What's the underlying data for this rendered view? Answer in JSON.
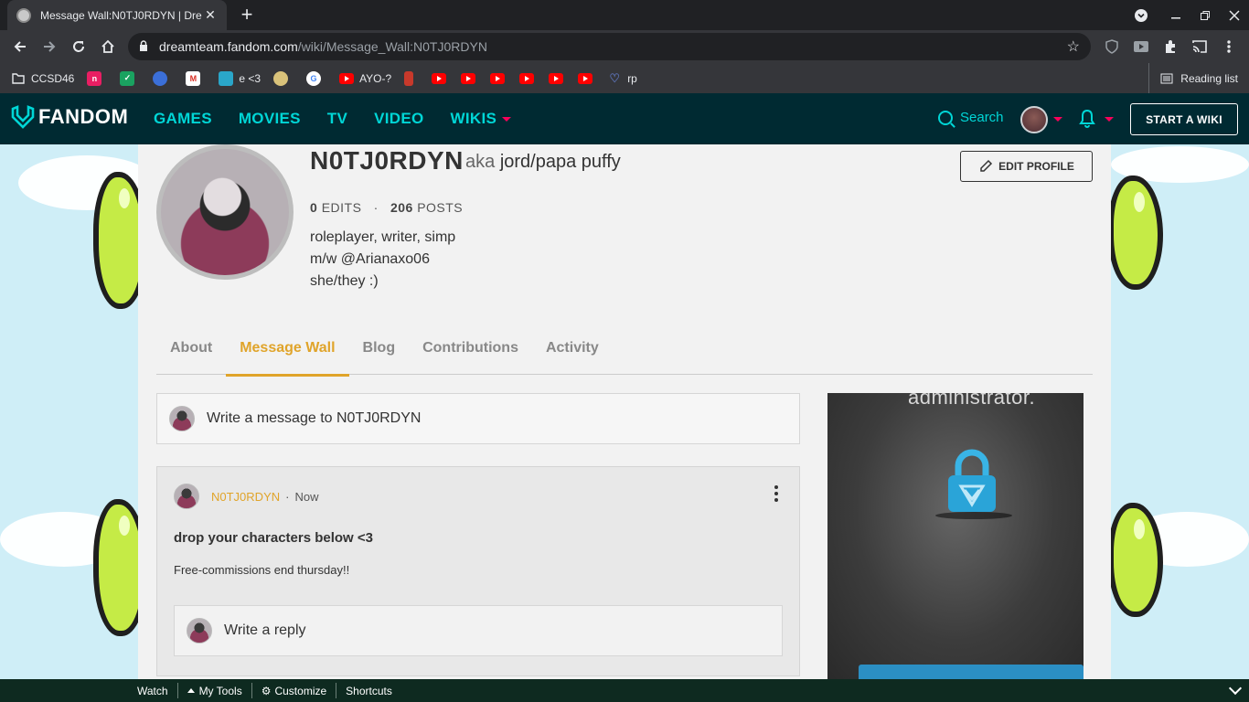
{
  "browser": {
    "tab_title": "Message Wall:N0TJ0RDYN | Dre",
    "tab_close": "✕",
    "new_tab": "+",
    "url_host": "dreamteam.fandom.com",
    "url_path": "/wiki/Message_Wall:N0TJ0RDYN",
    "bookmarks": [
      {
        "label": "CCSD46",
        "icon": "folder-icon"
      },
      {
        "label": "",
        "icon": "n-icon"
      },
      {
        "label": "",
        "icon": "green-shield-icon"
      },
      {
        "label": "",
        "icon": "globe-icon"
      },
      {
        "label": "",
        "icon": "gmail-icon"
      },
      {
        "label": "e <3",
        "icon": "portrait-icon"
      },
      {
        "label": "",
        "icon": "face-icon"
      },
      {
        "label": "",
        "icon": "google-icon"
      },
      {
        "label": "AYO-?",
        "icon": "youtube-icon"
      },
      {
        "label": "",
        "icon": "popcorn-icon"
      },
      {
        "label": "",
        "icon": "youtube-icon"
      },
      {
        "label": "",
        "icon": "youtube-icon"
      },
      {
        "label": "",
        "icon": "youtube-icon"
      },
      {
        "label": "",
        "icon": "youtube-icon"
      },
      {
        "label": "",
        "icon": "youtube-icon"
      },
      {
        "label": "",
        "icon": "youtube-icon"
      },
      {
        "label": "rp",
        "icon": "heart-icon"
      }
    ],
    "reading_list": "Reading list"
  },
  "fandom_nav": {
    "logo": "FANDOM",
    "links": [
      "GAMES",
      "MOVIES",
      "TV",
      "VIDEO",
      "WIKIS"
    ],
    "search": "Search",
    "start_wiki": "START A WIKI"
  },
  "profile": {
    "username": "N0TJ0RDYN",
    "aka_label": "aka",
    "aka": "jord/papa puffy",
    "edits_count": "0",
    "edits_label": "EDITS",
    "separator": "·",
    "posts_count": "206",
    "posts_label": "POSTS",
    "bio": [
      "roleplayer, writer, simp",
      "m/w @Arianaxo06",
      "she/they :)"
    ],
    "edit_profile": "EDIT PROFILE"
  },
  "tabs": [
    {
      "label": "About",
      "active": false
    },
    {
      "label": "Message Wall",
      "active": true
    },
    {
      "label": "Blog",
      "active": false
    },
    {
      "label": "Contributions",
      "active": false
    },
    {
      "label": "Activity",
      "active": false
    }
  ],
  "composer_placeholder": "Write a message to N0TJ0RDYN",
  "post": {
    "author": "N0TJ0RDYN",
    "separator": "·",
    "time": "Now",
    "title": "drop your characters below <3",
    "body": "Free-commissions end thursday!!",
    "reply_placeholder": "Write a reply"
  },
  "ad": {
    "text": "administrator."
  },
  "bottom_toolbar": [
    "Watch",
    "My Tools",
    "Customize",
    "Shortcuts"
  ],
  "colors": {
    "accent": "#e0a42a",
    "fandom_teal": "#00d6d6",
    "nav_bg": "#002a32"
  }
}
